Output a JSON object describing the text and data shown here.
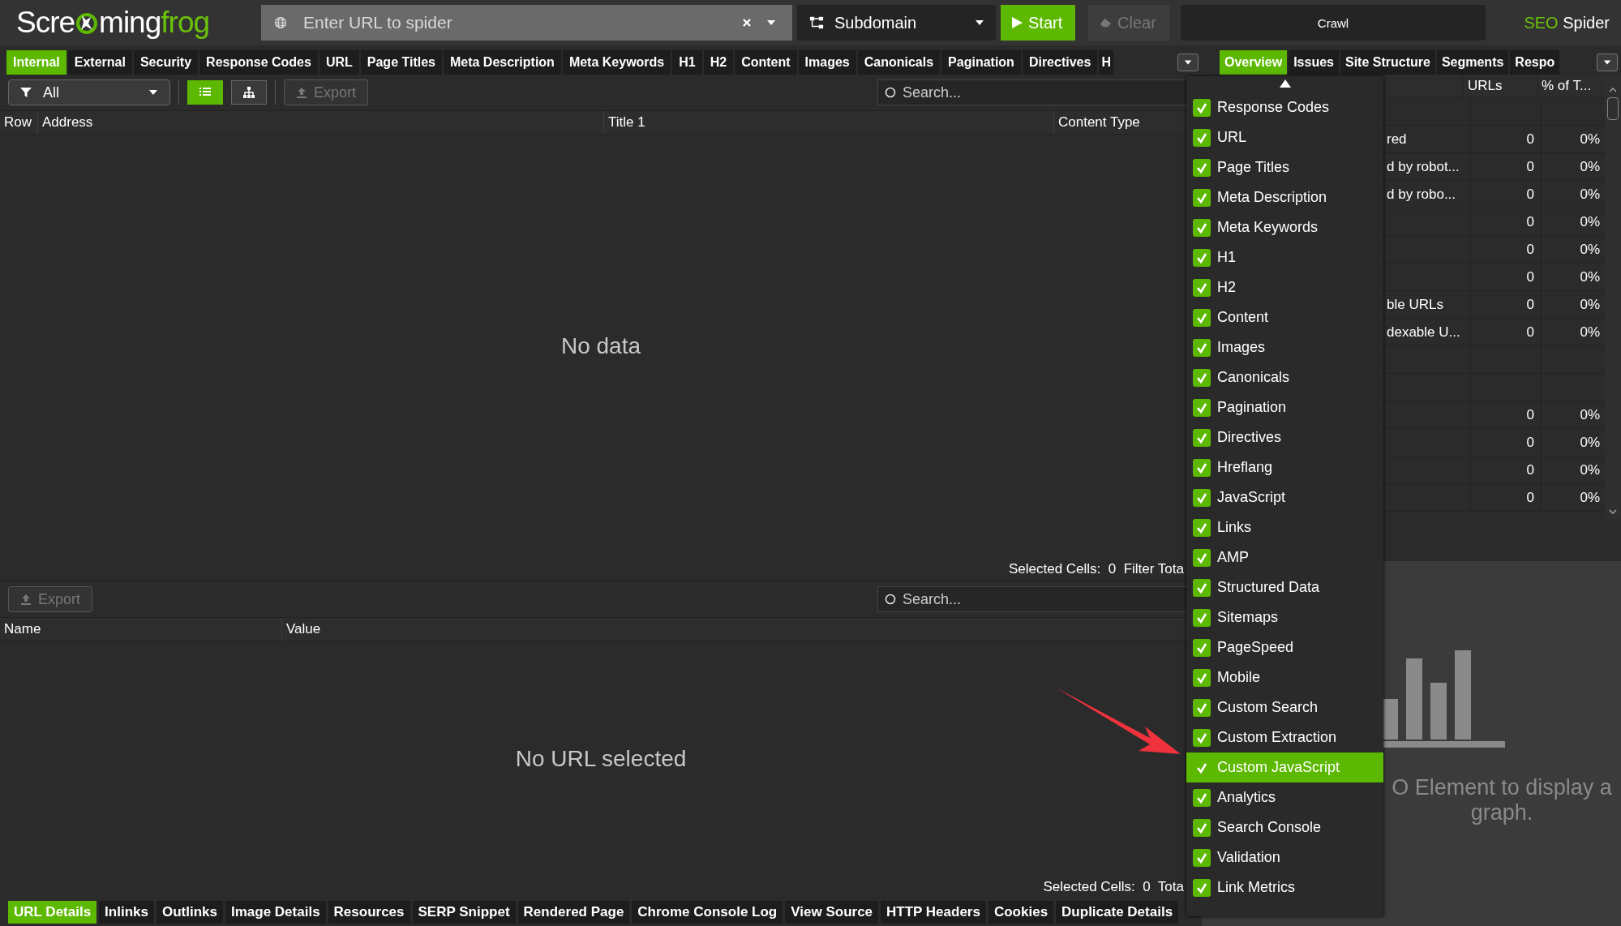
{
  "top_bar": {
    "logo": {
      "before": "Scre",
      "middle": "ming",
      "accent": "frog"
    },
    "url_field": {
      "placeholder": "Enter URL to spider"
    },
    "mode": {
      "value": "Subdomain"
    },
    "start_button": {
      "label": "Start"
    },
    "clear_button": {
      "label": "Clear",
      "disabled": true
    },
    "crawl_progress": {
      "label": "Crawl",
      "level": 0
    },
    "product": {
      "accent": "SEO",
      "rest": "Spider"
    }
  },
  "main_tabs": [
    {
      "label": "Internal",
      "selected": true
    },
    {
      "label": "External",
      "selected": false
    },
    {
      "label": "Security",
      "selected": false
    },
    {
      "label": "Response Codes",
      "selected": false
    },
    {
      "label": "URL",
      "selected": false
    },
    {
      "label": "Page Titles",
      "selected": false
    },
    {
      "label": "Meta Description",
      "selected": false
    },
    {
      "label": "Meta Keywords",
      "selected": false
    },
    {
      "label": "H1",
      "selected": false
    },
    {
      "label": "H2",
      "selected": false
    },
    {
      "label": "Content",
      "selected": false
    },
    {
      "label": "Images",
      "selected": false
    },
    {
      "label": "Canonicals",
      "selected": false
    },
    {
      "label": "Pagination",
      "selected": false
    },
    {
      "label": "Directives",
      "selected": false
    },
    {
      "label": "H",
      "selected": false
    }
  ],
  "upper_table": {
    "filter": {
      "value": "All"
    },
    "views": [
      {
        "kind": "list",
        "selected": true
      },
      {
        "kind": "tree",
        "selected": false
      }
    ],
    "export_button": {
      "label": "Export",
      "disabled": true
    },
    "search": {
      "placeholder": "Search..."
    },
    "columns": [
      "Row",
      "Address",
      "Title 1",
      "Content Type"
    ],
    "empty_text": "No data",
    "status": "Selected Cells:  0  Filter Tota"
  },
  "lower_table": {
    "export_button": {
      "label": "Export",
      "disabled": true
    },
    "search": {
      "placeholder": "Search..."
    },
    "columns": [
      "Name",
      "Value"
    ],
    "empty_text": "No URL selected",
    "status": "Selected Cells:  0  Tota"
  },
  "bottom_tabs": [
    {
      "label": "URL Details",
      "selected": true
    },
    {
      "label": "Inlinks",
      "selected": false
    },
    {
      "label": "Outlinks",
      "selected": false
    },
    {
      "label": "Image Details",
      "selected": false
    },
    {
      "label": "Resources",
      "selected": false
    },
    {
      "label": "SERP Snippet",
      "selected": false
    },
    {
      "label": "Rendered Page",
      "selected": false
    },
    {
      "label": "Chrome Console Log",
      "selected": false
    },
    {
      "label": "View Source",
      "selected": false
    },
    {
      "label": "HTTP Headers",
      "selected": false
    },
    {
      "label": "Cookies",
      "selected": false
    },
    {
      "label": "Duplicate Details",
      "selected": false
    }
  ],
  "right_panel": {
    "tabs": [
      {
        "label": "Overview",
        "selected": true
      },
      {
        "label": "Issues",
        "selected": false
      },
      {
        "label": "Site Structure",
        "selected": false
      },
      {
        "label": "Segments",
        "selected": false
      },
      {
        "label": "Respo",
        "selected": false
      }
    ],
    "columns": [
      "URLs",
      "% of T..."
    ],
    "rows": [
      {
        "kind": "blank"
      },
      {
        "kind": "value",
        "name": "red",
        "urls": "0",
        "percent": "0%"
      },
      {
        "kind": "value",
        "name": "d by robot...",
        "urls": "0",
        "percent": "0%"
      },
      {
        "kind": "value",
        "name": "d by robo...",
        "urls": "0",
        "percent": "0%"
      },
      {
        "kind": "value",
        "urls": "0",
        "percent": "0%"
      },
      {
        "kind": "value",
        "urls": "0",
        "percent": "0%"
      },
      {
        "kind": "value",
        "urls": "0",
        "percent": "0%"
      },
      {
        "kind": "value",
        "name": "ble URLs",
        "urls": "0",
        "percent": "0%"
      },
      {
        "kind": "value",
        "name": "dexable U...",
        "urls": "0",
        "percent": "0%"
      },
      {
        "kind": "blank"
      },
      {
        "kind": "blank"
      },
      {
        "kind": "value",
        "urls": "0",
        "percent": "0%"
      },
      {
        "kind": "value",
        "urls": "0",
        "percent": "0%"
      },
      {
        "kind": "value",
        "urls": "0",
        "percent": "0%"
      },
      {
        "kind": "value",
        "urls": "0",
        "percent": "0%"
      }
    ],
    "graph_hint": "O Element to display a graph."
  },
  "column_menu": {
    "items": [
      {
        "label": "Response Codes",
        "checked": true,
        "selected": false
      },
      {
        "label": "URL",
        "checked": true,
        "selected": false
      },
      {
        "label": "Page Titles",
        "checked": true,
        "selected": false
      },
      {
        "label": "Meta Description",
        "checked": true,
        "selected": false
      },
      {
        "label": "Meta Keywords",
        "checked": true,
        "selected": false
      },
      {
        "label": "H1",
        "checked": true,
        "selected": false
      },
      {
        "label": "H2",
        "checked": true,
        "selected": false
      },
      {
        "label": "Content",
        "checked": true,
        "selected": false
      },
      {
        "label": "Images",
        "checked": true,
        "selected": false
      },
      {
        "label": "Canonicals",
        "checked": true,
        "selected": false
      },
      {
        "label": "Pagination",
        "checked": true,
        "selected": false
      },
      {
        "label": "Directives",
        "checked": true,
        "selected": false
      },
      {
        "label": "Hreflang",
        "checked": true,
        "selected": false
      },
      {
        "label": "JavaScript",
        "checked": true,
        "selected": false
      },
      {
        "label": "Links",
        "checked": true,
        "selected": false
      },
      {
        "label": "AMP",
        "checked": true,
        "selected": false
      },
      {
        "label": "Structured Data",
        "checked": true,
        "selected": false
      },
      {
        "label": "Sitemaps",
        "checked": true,
        "selected": false
      },
      {
        "label": "PageSpeed",
        "checked": true,
        "selected": false
      },
      {
        "label": "Mobile",
        "checked": true,
        "selected": false
      },
      {
        "label": "Custom Search",
        "checked": true,
        "selected": false
      },
      {
        "label": "Custom Extraction",
        "checked": true,
        "selected": false
      },
      {
        "label": "Custom JavaScript",
        "checked": true,
        "selected": true
      },
      {
        "label": "Analytics",
        "checked": true,
        "selected": false
      },
      {
        "label": "Search Console",
        "checked": true,
        "selected": false
      },
      {
        "label": "Validation",
        "checked": true,
        "selected": false
      },
      {
        "label": "Link Metrics",
        "checked": true,
        "selected": false
      }
    ]
  }
}
